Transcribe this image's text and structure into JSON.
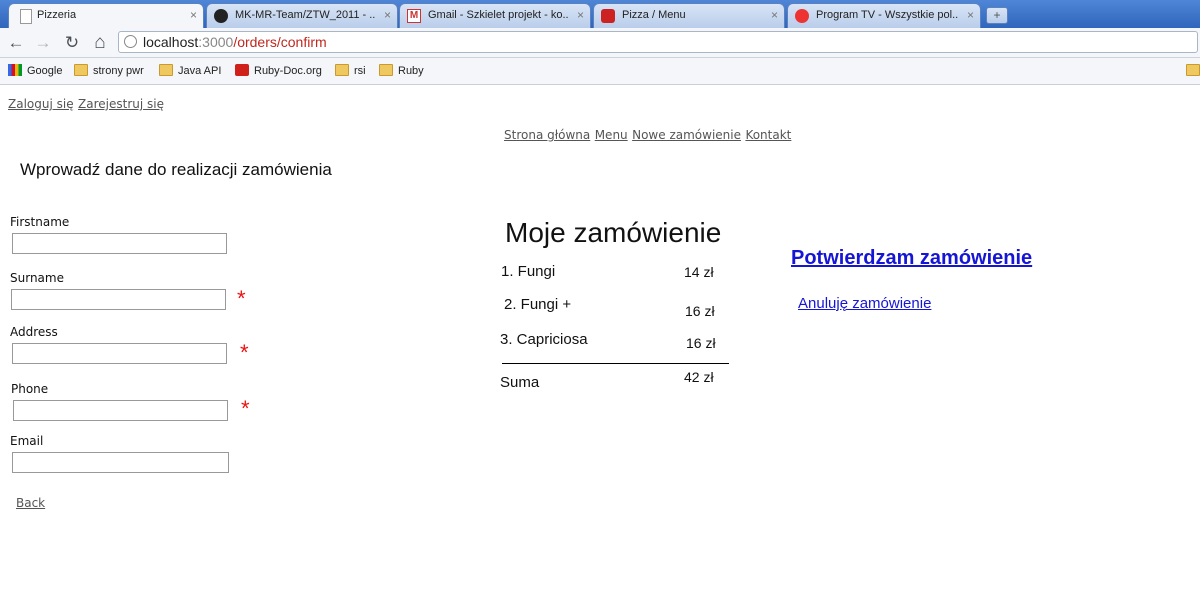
{
  "browser": {
    "tabs": [
      {
        "title": "Pizzeria",
        "close": "×"
      },
      {
        "title": "MK-MR-Team/ZTW_2011 - ...",
        "close": "×"
      },
      {
        "title": "Gmail - Szkielet projekt - ko...",
        "close": "×"
      },
      {
        "title": "Pizza / Menu",
        "close": "×"
      },
      {
        "title": "Program TV - Wszystkie pol...",
        "close": "×"
      }
    ],
    "new_tab": "+",
    "nav": {
      "back": "←",
      "forward": "→",
      "reload": "↻",
      "home": "⌂"
    },
    "url": {
      "host": "localhost",
      "port": ":3000",
      "path": "/orders/confirm"
    },
    "bookmarks": [
      "Google",
      "strony pwr",
      "Java API",
      "Ruby-Doc.org",
      "rsi",
      "Ruby"
    ]
  },
  "page": {
    "auth": {
      "login": "Zaloguj się",
      "register": "Zarejestruj się"
    },
    "nav": {
      "home": "Strona główna",
      "menu": "Menu",
      "new_order": "Nowe zamówienie",
      "contact": "Kontakt"
    },
    "form": {
      "title": "Wprowadź dane do realizacji zamówienia",
      "fields": [
        {
          "label": "Firstname",
          "value": ""
        },
        {
          "label": "Surname",
          "value": ""
        },
        {
          "label": "Address",
          "value": ""
        },
        {
          "label": "Phone",
          "value": ""
        },
        {
          "label": "Email",
          "value": ""
        }
      ],
      "required_mark": "*",
      "back": "Back"
    },
    "order": {
      "title": "Moje zamówienie",
      "items": [
        {
          "name": "1. Fungi",
          "price": "14 zł"
        },
        {
          "name": "2. Fungi +",
          "price": "16 zł"
        },
        {
          "name": "3. Capriciosa",
          "price": "16 zł"
        }
      ],
      "total_label": "Suma",
      "total": "42 zł"
    },
    "actions": {
      "confirm": "Potwierdzam zamówienie",
      "cancel": "Anuluję zamówienie"
    }
  },
  "colors": {
    "link_blue": "#1515d6",
    "required_red": "#e11111",
    "url_path": "#c0271f"
  }
}
